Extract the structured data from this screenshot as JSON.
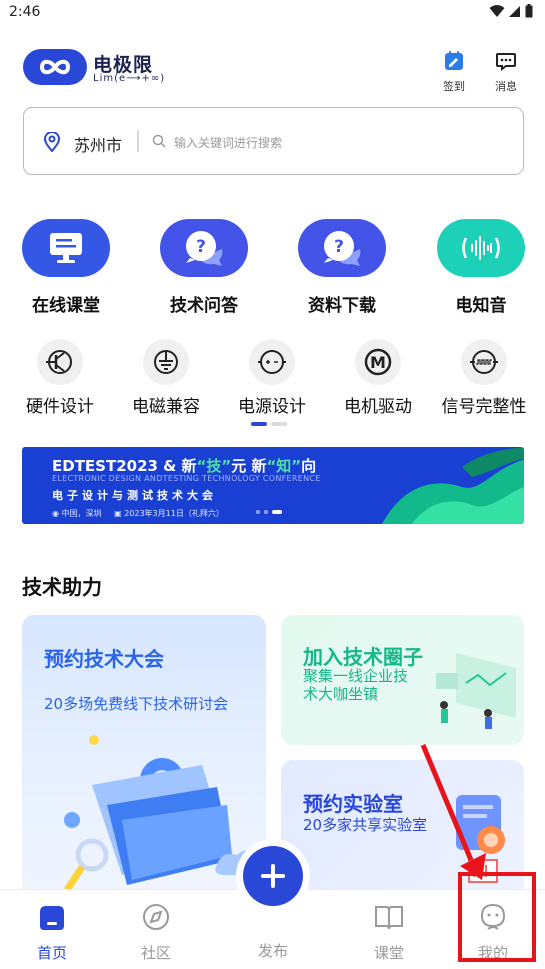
{
  "status_bar": {
    "time": "2:46"
  },
  "header": {
    "app_name": "电极限",
    "app_sub": "Lim(e⟶+∞)",
    "checkin_label": "签到",
    "messages_label": "消息"
  },
  "search": {
    "city": "苏州市",
    "placeholder": "输入关键词进行搜索"
  },
  "main_categories": [
    {
      "label": "在线课堂",
      "icon": "monitor-icon",
      "color": "#3457e6"
    },
    {
      "label": "技术问答",
      "icon": "question-chat-icon",
      "color": "#4454e8"
    },
    {
      "label": "资料下载",
      "icon": "question-chat-icon",
      "color": "#4454e8"
    },
    {
      "label": "电知音",
      "icon": "sound-wave-icon",
      "color": "#1dd0b8"
    }
  ],
  "sub_categories": [
    {
      "label": "硬件设计",
      "icon": "transistor-icon"
    },
    {
      "label": "电磁兼容",
      "icon": "ground-icon"
    },
    {
      "label": "电源设计",
      "icon": "power-source-icon"
    },
    {
      "label": "电机驱动",
      "icon": "motor-icon"
    },
    {
      "label": "信号完整性",
      "icon": "waveform-icon"
    }
  ],
  "banner": {
    "title_a": "EDTEST2023 & 新",
    "title_b": "“技”",
    "title_c": "元  新",
    "title_d": "“知”",
    "title_e": "向",
    "subtitle": "ELECTRONIC DESIGN ANDTESTING TECHNOLOGY CONFERENCE",
    "cn_title": "电子设计与测试技术大会",
    "location": "中国，深圳",
    "date": "2023年3月11日（礼拜六）"
  },
  "section": {
    "title": "技术助力"
  },
  "cards": {
    "conference": {
      "title": "预约技术大会",
      "subtitle": "20多场免费线下技术研讨会"
    },
    "circle": {
      "title": "加入技术圈子",
      "subtitle_1": "聚集一线企业技",
      "subtitle_2": "术大咖坐镇"
    },
    "lab": {
      "title": "预约实验室",
      "subtitle": "20多家共享实验室"
    }
  },
  "tabs": [
    {
      "label": "首页",
      "active": true
    },
    {
      "label": "社区",
      "active": false
    },
    {
      "label": "发布",
      "active": false
    },
    {
      "label": "课堂",
      "active": false
    },
    {
      "label": "我的",
      "active": false
    }
  ],
  "colors": {
    "accent": "#2a48d8",
    "annotation": "#e8131b",
    "teal": "#1dd0b8"
  }
}
